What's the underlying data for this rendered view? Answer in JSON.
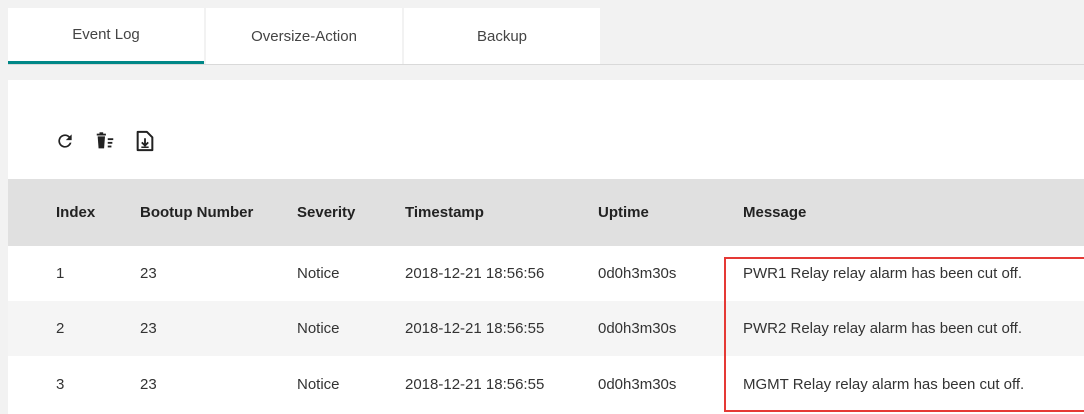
{
  "tabs": [
    {
      "label": "Event Log",
      "active": true
    },
    {
      "label": "Oversize-Action",
      "active": false
    },
    {
      "label": "Backup",
      "active": false
    }
  ],
  "toolbar": {
    "icons": [
      "refresh-icon",
      "clear-log-icon",
      "export-icon"
    ]
  },
  "table": {
    "headers": {
      "index": "Index",
      "bootup": "Bootup Number",
      "severity": "Severity",
      "timestamp": "Timestamp",
      "uptime": "Uptime",
      "message": "Message"
    },
    "rows": [
      {
        "index": "1",
        "bootup": "23",
        "severity": "Notice",
        "timestamp": "2018-12-21 18:56:56",
        "uptime": "0d0h3m30s",
        "message": "PWR1 Relay relay alarm has been cut off."
      },
      {
        "index": "2",
        "bootup": "23",
        "severity": "Notice",
        "timestamp": "2018-12-21 18:56:55",
        "uptime": "0d0h3m30s",
        "message": "PWR2 Relay relay alarm has been cut off."
      },
      {
        "index": "3",
        "bootup": "23",
        "severity": "Notice",
        "timestamp": "2018-12-21 18:56:55",
        "uptime": "0d0h3m30s",
        "message": "MGMT Relay relay alarm has been cut off."
      }
    ]
  },
  "colors": {
    "accent": "#008787",
    "highlight": "#e53935"
  }
}
